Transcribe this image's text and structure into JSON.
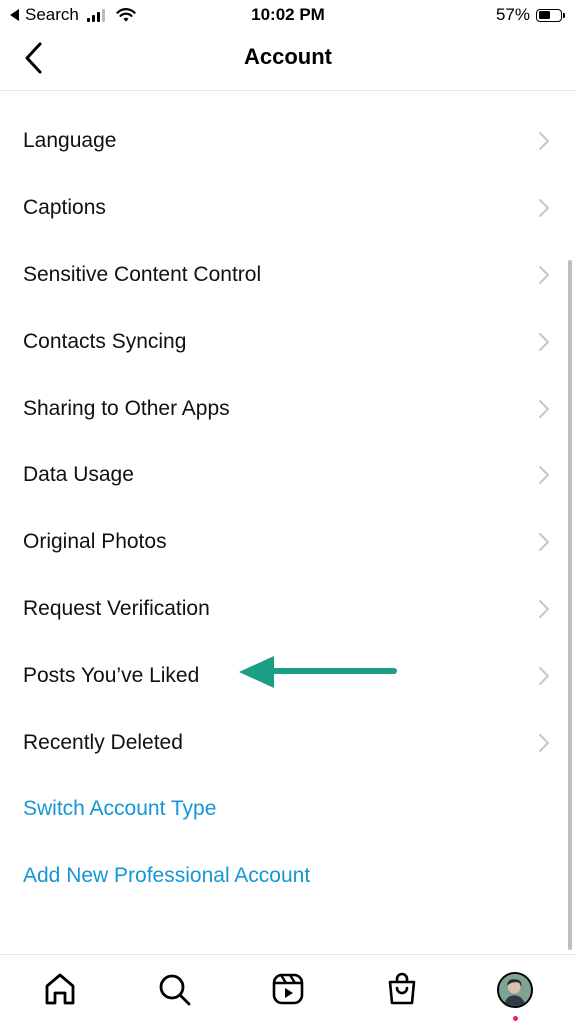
{
  "status_bar": {
    "carrier": "Search",
    "time": "10:02 PM",
    "battery_percent": "57%",
    "battery_level": 0.57
  },
  "header": {
    "title": "Account",
    "back_icon": "chevron-left-icon"
  },
  "menu": {
    "items": [
      {
        "label": "Language"
      },
      {
        "label": "Captions"
      },
      {
        "label": "Sensitive Content Control"
      },
      {
        "label": "Contacts Syncing"
      },
      {
        "label": "Sharing to Other Apps"
      },
      {
        "label": "Data Usage"
      },
      {
        "label": "Original Photos"
      },
      {
        "label": "Request Verification"
      },
      {
        "label": "Posts You’ve Liked"
      },
      {
        "label": "Recently Deleted"
      }
    ],
    "links": [
      {
        "label": "Switch Account Type"
      },
      {
        "label": "Add New Professional Account"
      }
    ]
  },
  "tab_bar": {
    "tabs": [
      "home-icon",
      "search-icon",
      "reels-icon",
      "shop-icon",
      "profile-avatar"
    ]
  },
  "colors": {
    "link": "#1596d6",
    "arrow": "#1a9e86",
    "notification_dot": "#ed2456"
  }
}
